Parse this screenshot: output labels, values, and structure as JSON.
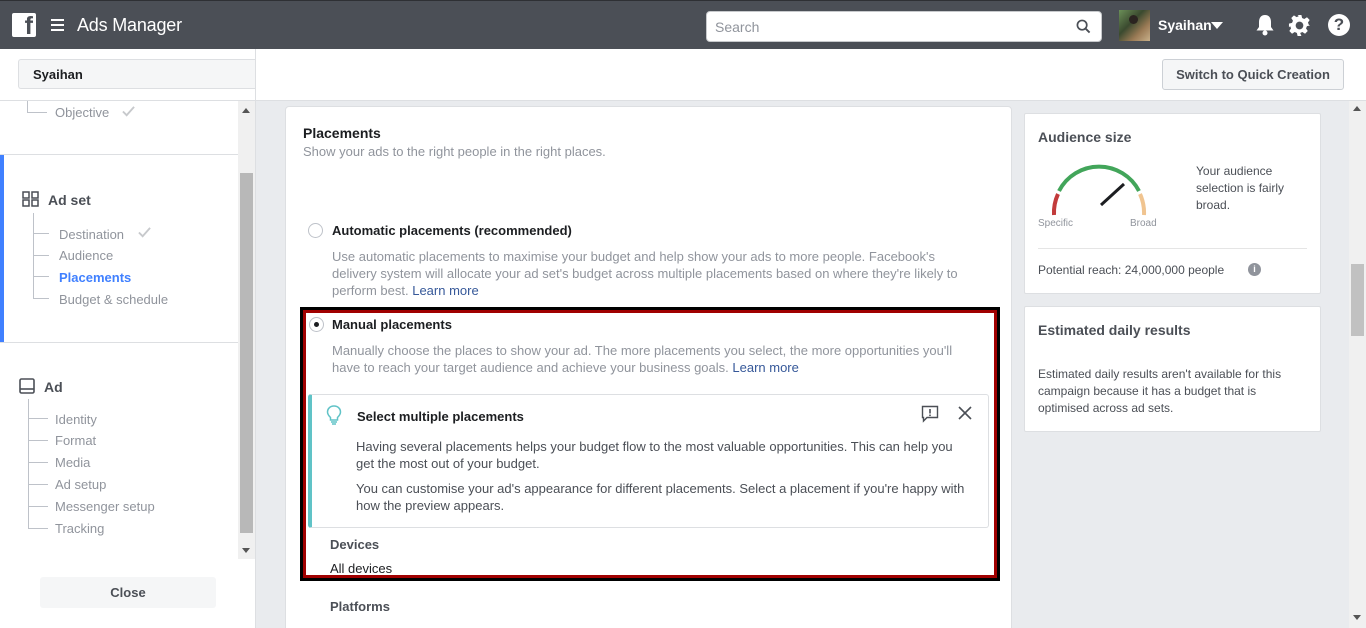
{
  "header": {
    "logo": "f",
    "title": "Ads Manager",
    "search_placeholder": "Search",
    "user_name": "Syaihan",
    "help": "?"
  },
  "subheader": {
    "account": "Syaihan",
    "quick_creation": "Switch to Quick Creation"
  },
  "sidebar": {
    "campaign_items": [
      {
        "label": "Objective",
        "done": true
      }
    ],
    "adset_title": "Ad set",
    "adset_items": [
      {
        "label": "Destination",
        "done": true
      },
      {
        "label": "Audience"
      },
      {
        "label": "Placements",
        "active": true
      },
      {
        "label": "Budget & schedule"
      }
    ],
    "ad_title": "Ad",
    "ad_items": [
      {
        "label": "Identity"
      },
      {
        "label": "Format"
      },
      {
        "label": "Media"
      },
      {
        "label": "Ad setup"
      },
      {
        "label": "Messenger setup"
      },
      {
        "label": "Tracking"
      }
    ],
    "close": "Close"
  },
  "main": {
    "title": "Placements",
    "subtitle": "Show your ads to the right people in the right places.",
    "auto": {
      "title": "Automatic placements (recommended)",
      "desc_1": "Use automatic placements to maximise your budget and help show your ads to more people. Facebook's",
      "desc_2": "delivery system will allocate your ad set's budget across multiple placements based on where they're likely to",
      "desc_3": "perform best.",
      "link": "Learn more"
    },
    "manual": {
      "title": "Manual placements",
      "desc_1": "Manually choose the places to show your ad. The more placements you select, the more opportunities you'll",
      "desc_2": "have to reach your target audience and achieve your business goals.",
      "link": "Learn more"
    },
    "tip": {
      "title": "Select multiple placements",
      "text_1a": "Having several placements helps your budget flow to the most valuable opportunities. This can help you",
      "text_1b": "get the most out of your budget.",
      "text_2a": "You can customise your ad's appearance for different placements. Select a placement if you're happy with",
      "text_2b": "how the preview appears."
    },
    "devices_label": "Devices",
    "devices_value": "All devices",
    "platforms_label": "Platforms"
  },
  "audience": {
    "title": "Audience size",
    "specific": "Specific",
    "broad": "Broad",
    "description_1": "Your audience",
    "description_2": "selection is fairly",
    "description_3": "broad.",
    "reach": "Potential reach: 24,000,000 people",
    "info": "i"
  },
  "estimated": {
    "title": "Estimated daily results",
    "text_1": "Estimated daily results aren't available for this",
    "text_2": "campaign because it has a budget that is",
    "text_3": "optimised across ad sets."
  },
  "colors": {
    "topbar": "#4b4f56",
    "accent": "#4080ff",
    "link": "#365899",
    "highlight_border": "#a00000",
    "tip_accent": "#60c3c7"
  }
}
